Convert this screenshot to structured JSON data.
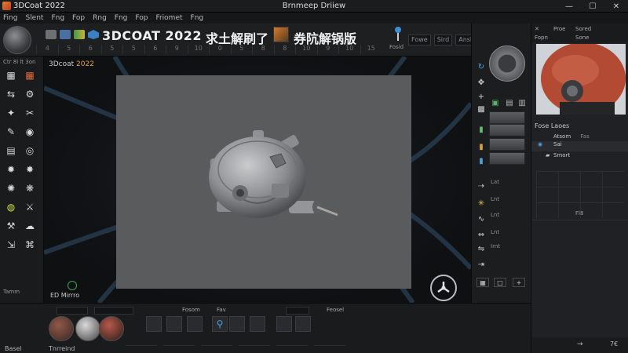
{
  "app": {
    "title": "3DCoat 2022",
    "window_title": "Brnmeep Driiew",
    "controls": [
      "—",
      "☐",
      "✕"
    ]
  },
  "menu": [
    "Fing",
    "Slent",
    "Fng",
    "Fop",
    "Rng",
    "Fng",
    "Fop",
    "Friomet",
    "Fng"
  ],
  "toolbar": {
    "banner": "3DCOAT 2022",
    "banner_cjk": "求土解刷了",
    "banner_cjk2": "券阬解锅版",
    "ruler": [
      "4",
      "5",
      "6",
      "5",
      "5",
      "6",
      "9",
      "10",
      "0",
      "5",
      "8",
      "8",
      "10",
      "9",
      "10",
      "15"
    ],
    "field_1": "Fowe",
    "field_2": "Sird",
    "field_3": "Ansl Fonnel",
    "corner_label": "Fosid"
  },
  "left_tools": {
    "label_top": "Ctr 8i lt 3on",
    "label_bottom": "Tamm"
  },
  "viewport": {
    "title_prefix": "3Dcoat",
    "title_year": "2022",
    "mode_label": "ED Mirrro"
  },
  "right_tools": {
    "labels": [
      "Lat",
      "Lnt",
      "Lnt",
      "Lnt",
      "Irnt"
    ]
  },
  "right_panel": {
    "tabs": [
      "Proe",
      "Sored",
      "Fopn",
      "Sone"
    ],
    "layers_title": "Fose Laoes",
    "layers": [
      {
        "name": "Atsom",
        "extra": "Fas"
      },
      {
        "name": "Sai"
      },
      {
        "name": "Smort"
      }
    ],
    "grid_label": "Fl8"
  },
  "bottom": {
    "left_label": "Basel",
    "mid_label": "Tnrreind",
    "right_label": "Feosel",
    "labels": [
      "Fosom",
      "Fav"
    ]
  },
  "colors": {
    "accent": "#e8a33c",
    "banner": "#f0f0f0",
    "helmet": "#c8553d"
  }
}
